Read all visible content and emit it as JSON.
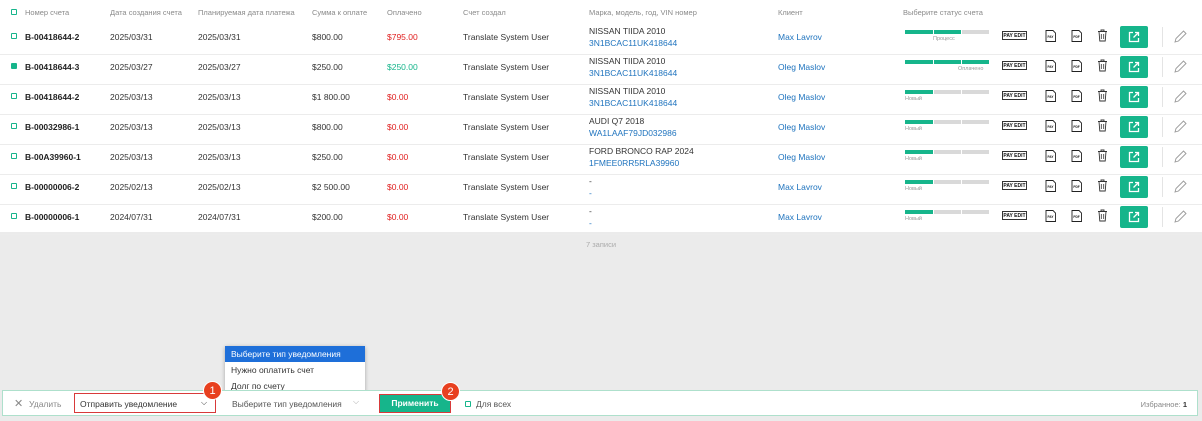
{
  "columns": [
    "Номер счета",
    "Дата создания счета",
    "Планируемая дата платежа",
    "Сумма к оплате",
    "Оплачено",
    "Счет создал",
    "Марка, модель, год, VIN номер",
    "Клиент",
    "Выберите статус счета"
  ],
  "rows": [
    {
      "checked": false,
      "number": "B-00418644-2",
      "created": "2025/03/31",
      "planned": "2025/03/31",
      "amount": "$800.00",
      "paid": "$795.00",
      "paid_color": "red",
      "creator": "Translate System User",
      "car": "NISSAN TIIDA 2010",
      "vin": "3N1BCAC11UK418644",
      "client": "Max Lavrov",
      "status_label": "Процесс",
      "status_progress": 0.67,
      "status_label_pos": "center"
    },
    {
      "checked": true,
      "number": "B-00418644-3",
      "created": "2025/03/27",
      "planned": "2025/03/27",
      "amount": "$250.00",
      "paid": "$250.00",
      "paid_color": "green",
      "creator": "Translate System User",
      "car": "NISSAN TIIDA 2010",
      "vin": "3N1BCAC11UK418644",
      "client": "Oleg Maslov",
      "status_label": "Оплачено",
      "status_progress": 1.0,
      "status_label_pos": "right"
    },
    {
      "checked": false,
      "number": "B-00418644-2",
      "created": "2025/03/13",
      "planned": "2025/03/13",
      "amount": "$1 800.00",
      "paid": "$0.00",
      "paid_color": "red",
      "creator": "Translate System User",
      "car": "NISSAN TIIDA 2010",
      "vin": "3N1BCAC11UK418644",
      "client": "Oleg Maslov",
      "status_label": "Новый",
      "status_progress": 0.33,
      "status_label_pos": "left"
    },
    {
      "checked": false,
      "number": "B-00032986-1",
      "created": "2025/03/13",
      "planned": "2025/03/13",
      "amount": "$800.00",
      "paid": "$0.00",
      "paid_color": "red",
      "creator": "Translate System User",
      "car": "AUDI Q7 2018",
      "vin": "WA1LAAF79JD032986",
      "client": "Oleg Maslov",
      "status_label": "Новый",
      "status_progress": 0.33,
      "status_label_pos": "left"
    },
    {
      "checked": false,
      "number": "B-00A39960-1",
      "created": "2025/03/13",
      "planned": "2025/03/13",
      "amount": "$250.00",
      "paid": "$0.00",
      "paid_color": "red",
      "creator": "Translate System User",
      "car": "FORD BRONCO RAP 2024",
      "vin": "1FMEE0RR5RLA39960",
      "client": "Oleg Maslov",
      "status_label": "Новый",
      "status_progress": 0.33,
      "status_label_pos": "left"
    },
    {
      "checked": false,
      "number": "B-00000006-2",
      "created": "2025/02/13",
      "planned": "2025/02/13",
      "amount": "$2 500.00",
      "paid": "$0.00",
      "paid_color": "red",
      "creator": "Translate System User",
      "car": "-",
      "vin": "-",
      "client": "Max Lavrov",
      "status_label": "Новый",
      "status_progress": 0.33,
      "status_label_pos": "left"
    },
    {
      "checked": false,
      "number": "B-00000006-1",
      "created": "2024/07/31",
      "planned": "2024/07/31",
      "amount": "$200.00",
      "paid": "$0.00",
      "paid_color": "red",
      "creator": "Translate System User",
      "car": "-",
      "vin": "-",
      "client": "Max Lavrov",
      "status_label": "Новый",
      "status_progress": 0.33,
      "status_label_pos": "left"
    }
  ],
  "row_actions": {
    "pay_edit": "PAY EDIT",
    "doc1": "PAY",
    "doc2": "PDF"
  },
  "records_text": "7 записи",
  "dropdown": {
    "options": [
      "Выберите тип уведомления",
      "Нужно оплатить счет",
      "Долг по счету"
    ],
    "selected_index": 0
  },
  "footer": {
    "delete_label": "Удалить",
    "action_select": "Отправить уведомление",
    "type_select": "Выберите тип уведомления",
    "apply_label": "Применить",
    "for_all_label": "Для всех",
    "favorites_label": "Избранное:",
    "favorites_count": "1"
  },
  "badges": [
    "1",
    "2"
  ],
  "colors": {
    "accent": "#16b58b",
    "link": "#1e73be",
    "danger": "#e02020",
    "highlight": "#d83a3a",
    "badge": "#e8401f"
  }
}
